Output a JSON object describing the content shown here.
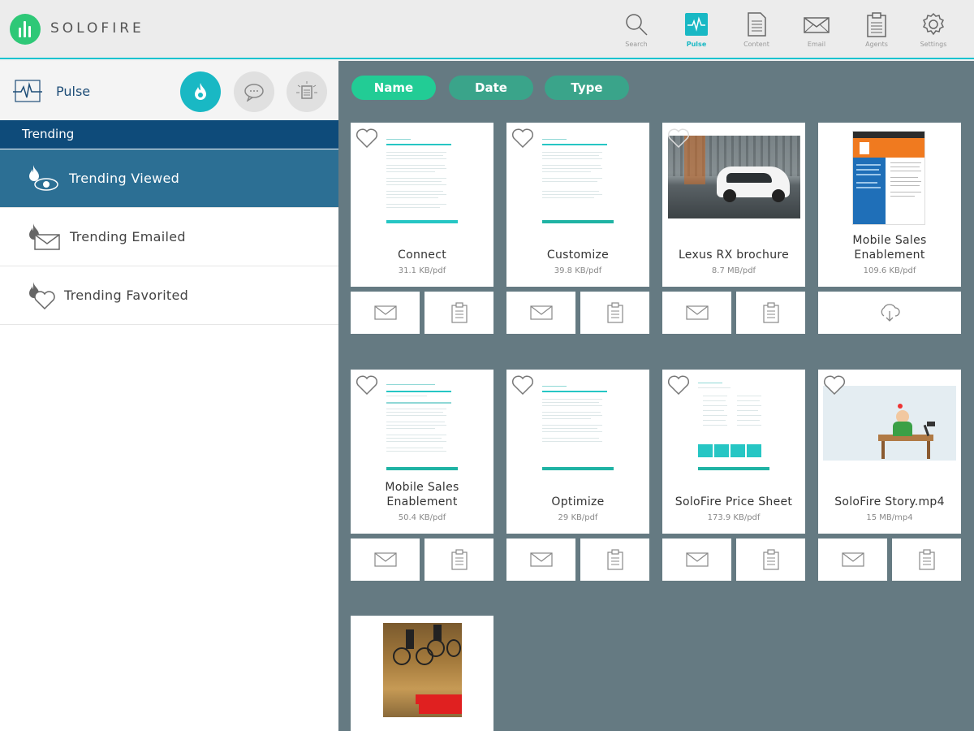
{
  "app": {
    "brand": "SOLOFIRE",
    "nav": [
      {
        "label": "Search",
        "icon": "search-icon"
      },
      {
        "label": "Pulse",
        "icon": "pulse-icon",
        "active": true
      },
      {
        "label": "Content",
        "icon": "document-icon"
      },
      {
        "label": "Email",
        "icon": "envelope-icon"
      },
      {
        "label": "Agents",
        "icon": "clipboard-icon"
      },
      {
        "label": "Settings",
        "icon": "gear-icon"
      }
    ]
  },
  "sidebar": {
    "pulse_label": "Pulse",
    "section_header": "Trending",
    "items": [
      {
        "label": "Trending Viewed",
        "icon": "trending-viewed-icon",
        "selected": true
      },
      {
        "label": "Trending Emailed",
        "icon": "trending-emailed-icon"
      },
      {
        "label": "Trending Favorited",
        "icon": "trending-favorited-icon"
      }
    ]
  },
  "sort": {
    "name": "Name",
    "date": "Date",
    "type": "Type"
  },
  "cards": [
    {
      "title": "Connect",
      "meta": "31.1 KB/pdf",
      "actions": [
        "email",
        "clipboard"
      ]
    },
    {
      "title": "Customize",
      "meta": "39.8 KB/pdf",
      "actions": [
        "email",
        "clipboard"
      ]
    },
    {
      "title": "Lexus RX brochure",
      "meta": "8.7 MB/pdf",
      "actions": [
        "email",
        "clipboard"
      ]
    },
    {
      "title": "Mobile Sales",
      "title2": "Enablement",
      "meta": "109.6 KB/pdf",
      "actions": [
        "download"
      ]
    },
    {
      "title": "Mobile Sales",
      "title2": "Enablement",
      "meta": "50.4 KB/pdf",
      "actions": [
        "email",
        "clipboard"
      ]
    },
    {
      "title": "Optimize",
      "meta": "29 KB/pdf",
      "actions": [
        "email",
        "clipboard"
      ]
    },
    {
      "title": "SoloFire Price Sheet",
      "meta": "173.9 KB/pdf",
      "actions": [
        "email",
        "clipboard"
      ]
    },
    {
      "title": "SoloFire Story.mp4",
      "meta": "15 MB/mp4",
      "actions": [
        "email",
        "clipboard"
      ]
    }
  ],
  "colors": {
    "accent": "#19b8c4",
    "sidebar_header": "#0e4b7a",
    "sidebar_selected": "#2c6f94",
    "main_bg": "#657a82",
    "pill_active": "#22cc95"
  }
}
